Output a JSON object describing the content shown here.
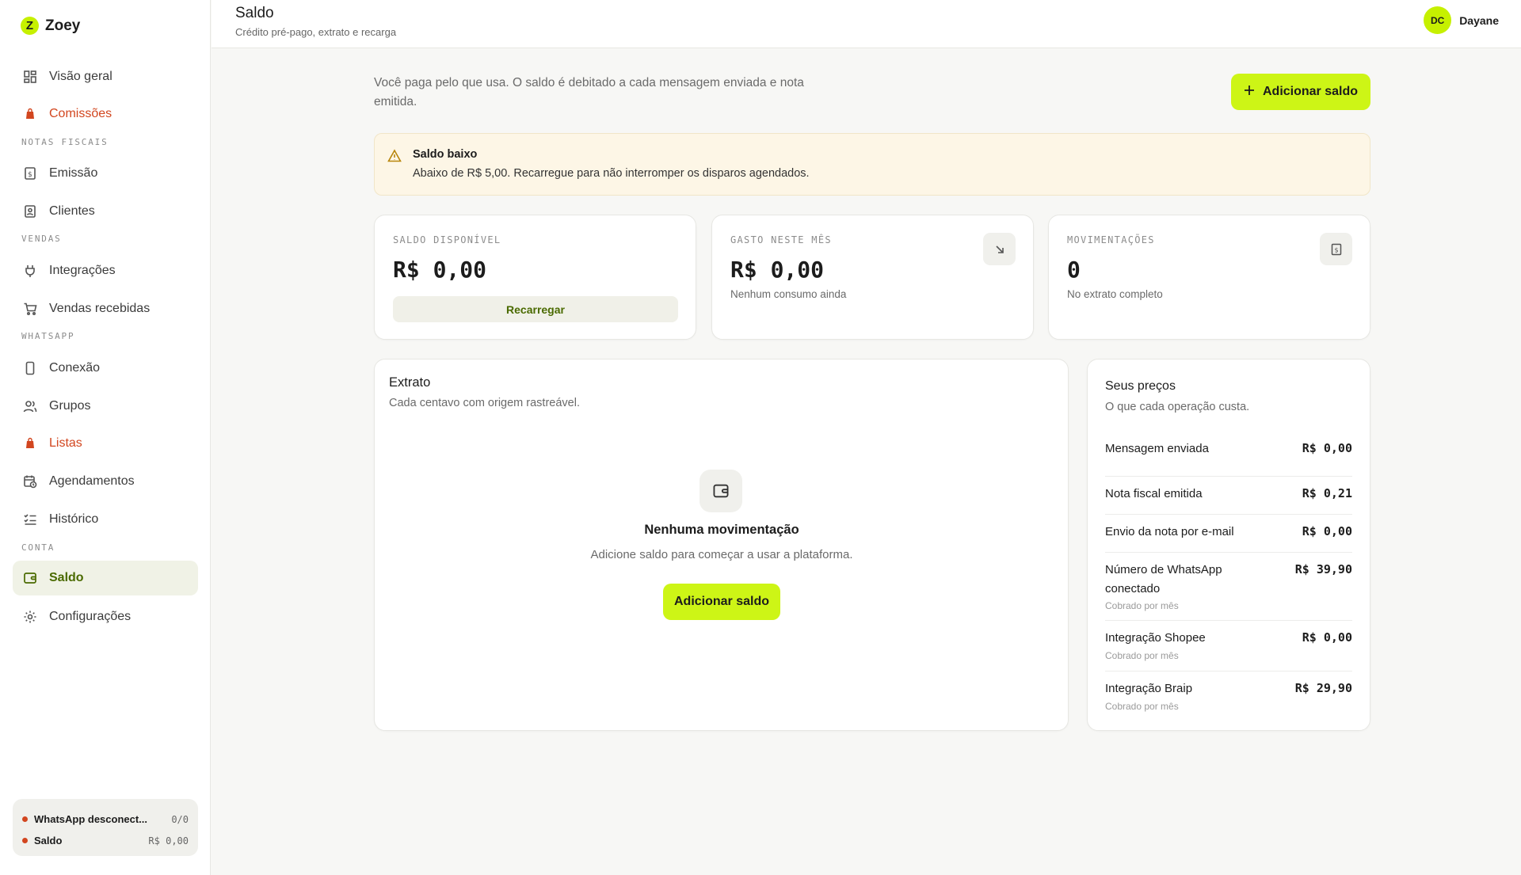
{
  "brand": {
    "logo_letter": "Z",
    "name": "Zoey",
    "accent": "#cdf516"
  },
  "sidebar": {
    "items": [
      {
        "label": "Visão geral",
        "icon": "grid-icon"
      },
      {
        "label": "Comissões",
        "icon": "bag-icon"
      },
      {
        "label": "Emissão",
        "icon": "invoice-icon"
      },
      {
        "label": "Clientes",
        "icon": "contact-icon"
      },
      {
        "label": "Integrações",
        "icon": "plug-icon"
      },
      {
        "label": "Vendas recebidas",
        "icon": "cart-icon"
      },
      {
        "label": "Conexão",
        "icon": "phone-icon"
      },
      {
        "label": "Grupos",
        "icon": "users-icon"
      },
      {
        "label": "Listas",
        "icon": "bag-icon"
      },
      {
        "label": "Agendamentos",
        "icon": "calendar-clock-icon"
      },
      {
        "label": "Histórico",
        "icon": "list-check-icon"
      },
      {
        "label": "Saldo",
        "icon": "wallet-icon"
      },
      {
        "label": "Configurações",
        "icon": "gear-icon"
      }
    ],
    "sections": {
      "notas_fiscais": "NOTAS FISCAIS",
      "vendas": "VENDAS",
      "whatsapp": "WHATSAPP",
      "conta": "CONTA"
    },
    "status": {
      "whatsapp_label": "WhatsApp desconect...",
      "whatsapp_value": "0/0",
      "saldo_label": "Saldo",
      "saldo_value": "R$ 0,00"
    }
  },
  "header": {
    "title": "Saldo",
    "subtitle": "Crédito pré-pago, extrato e recarga",
    "user_initials": "DC",
    "user_name": "Dayane"
  },
  "main": {
    "intro": "Você paga pelo que usa. O saldo é debitado a cada mensagem enviada e nota emitida.",
    "add_balance_label": "Adicionar saldo",
    "alert": {
      "title": "Saldo baixo",
      "text": "Abaixo de R$ 5,00. Recarregue para não interromper os disparos agendados."
    },
    "stats": [
      {
        "label": "SALDO DISPONÍVEL",
        "value": "R$ 0,00",
        "action": "Recarregar"
      },
      {
        "label": "GASTO NESTE MÊS",
        "value": "R$ 0,00",
        "note": "Nenhum consumo ainda",
        "icon": "arrow-down-right-icon"
      },
      {
        "label": "MOVIMENTAÇÕES",
        "value": "0",
        "note": "No extrato completo",
        "icon": "receipt-icon"
      }
    ],
    "extrato": {
      "title": "Extrato",
      "subtitle": "Cada centavo com origem rastreável.",
      "empty_title": "Nenhuma movimentação",
      "empty_text": "Adicione saldo para começar a usar a plataforma.",
      "empty_button": "Adicionar saldo"
    },
    "prices": {
      "title": "Seus preços",
      "subtitle": "O que cada operação custa.",
      "rows": [
        {
          "name": "Mensagem enviada",
          "value": "R$ 0,00"
        },
        {
          "name": "Nota fiscal emitida",
          "value": "R$ 0,21"
        },
        {
          "name": "Envio da nota por e-mail",
          "value": "R$ 0,00"
        },
        {
          "name": "Número de WhatsApp conectado",
          "value": "R$ 39,90",
          "note": "Cobrado por mês"
        },
        {
          "name": "Integração Shopee",
          "value": "R$ 0,00",
          "note": "Cobrado por mês"
        },
        {
          "name": "Integração Braip",
          "value": "R$ 29,90",
          "note": "Cobrado por mês"
        }
      ]
    }
  }
}
